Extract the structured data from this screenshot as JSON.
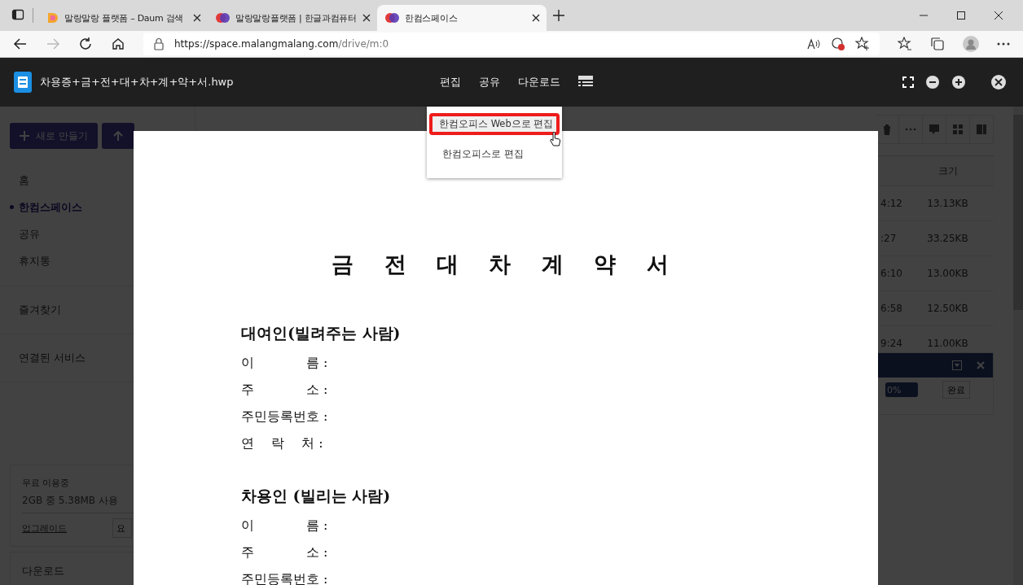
{
  "browser": {
    "tabs": [
      {
        "title": "말랑말랑 플랫폼 – Daum 검색",
        "selected": false
      },
      {
        "title": "말랑말랑플랫폼 | 한글과컴퓨터",
        "selected": false
      },
      {
        "title": "한컴스페이스",
        "selected": true
      }
    ],
    "url_host": "https://space.malangmalang.com",
    "url_path": "/drive/m:0"
  },
  "background": {
    "new_button": "새로 만들기",
    "nav": [
      {
        "label": "홈",
        "selected": false
      },
      {
        "label": "한컴스페이스",
        "selected": true
      },
      {
        "label": "공유",
        "selected": false
      },
      {
        "label": "휴지통",
        "selected": false
      }
    ],
    "favorites": "즐겨찾기",
    "connected": "연결된 서비스",
    "plan": {
      "title": "무료 이용중",
      "usage": "2GB 중 5.38MB 사용",
      "upgrade": "업그레이드",
      "plan_button": "요"
    },
    "downloads": "다운로드",
    "table": {
      "size_header": "크기",
      "rows": [
        {
          "time": "4:12",
          "size": "13.13KB"
        },
        {
          "time": ":27",
          "size": "33.25KB"
        },
        {
          "time": "6:10",
          "size": "13.00KB"
        },
        {
          "time": "6:58",
          "size": "12.50KB"
        },
        {
          "time": "9:24",
          "size": "11.00KB"
        }
      ]
    },
    "upload": {
      "progress": "0%",
      "level": 1,
      "done": "완료"
    }
  },
  "viewer": {
    "filename": "차용증+금+전+대+차+계+약+서.hwp",
    "menu": [
      "편집",
      "공유",
      "다운로드"
    ],
    "dropdown": [
      {
        "label": "한컴오피스 Web으로 편집",
        "highlighted": true
      },
      {
        "label": "한컴오피스로 편집",
        "highlighted": false
      }
    ]
  },
  "document": {
    "title": "금 전 대 차 계 약 서",
    "sections": [
      {
        "heading": "대여인(빌려주는 사람)",
        "fields": [
          "이　　　　름 :",
          "주　　　　소 :",
          "주민등록번호 :",
          "연　 락 　처 :"
        ]
      },
      {
        "heading": "차용인 (빌리는 사람)",
        "fields": [
          "이　　　　름 :",
          "주　　　　소 :",
          "주민등록번호 :"
        ]
      }
    ]
  }
}
